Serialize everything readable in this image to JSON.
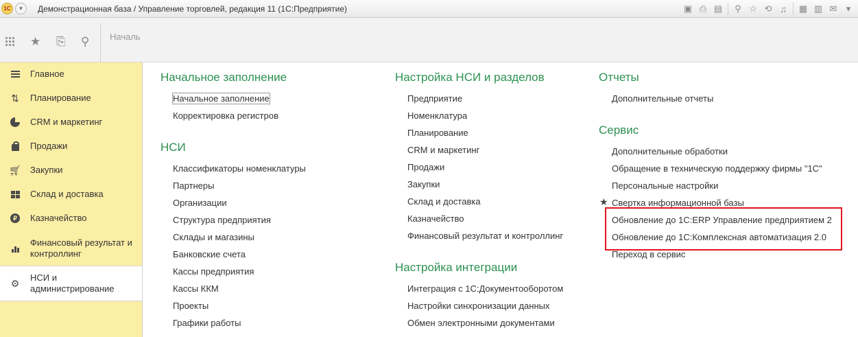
{
  "window": {
    "title": "Демонстрационная база / Управление торговлей, редакция 11  (1С:Предприятие)",
    "logo_text": "1С"
  },
  "tabs": {
    "partial_tab": "Началь"
  },
  "sidebar": {
    "items": [
      {
        "label": "Главное",
        "icon": "hamburger-icon"
      },
      {
        "label": "Планирование",
        "icon": "planning-icon"
      },
      {
        "label": "CRM и маркетинг",
        "icon": "pie-chart-icon"
      },
      {
        "label": "Продажи",
        "icon": "bag-icon"
      },
      {
        "label": "Закупки",
        "icon": "cart-icon"
      },
      {
        "label": "Склад и доставка",
        "icon": "warehouse-icon"
      },
      {
        "label": "Казначейство",
        "icon": "ruble-icon"
      },
      {
        "label": "Финансовый результат и контроллинг",
        "icon": "bar-chart-icon"
      },
      {
        "label": "НСИ и администрирование",
        "icon": "gear-icon",
        "active": true
      }
    ]
  },
  "columns": {
    "col1": {
      "sec1": "Начальное заполнение",
      "sec1_items": [
        "Начальное заполнение",
        "Корректировка регистров"
      ],
      "sec2": "НСИ",
      "sec2_items": [
        "Классификаторы номенклатуры",
        "Партнеры",
        "Организации",
        "Структура предприятия",
        "Склады и магазины",
        "Банковские счета",
        "Кассы предприятия",
        "Кассы ККМ",
        "Проекты",
        "Графики работы"
      ]
    },
    "col2": {
      "sec1": "Настройка НСИ и разделов",
      "sec1_items": [
        "Предприятие",
        "Номенклатура",
        "Планирование",
        "CRM и маркетинг",
        "Продажи",
        "Закупки",
        "Склад и доставка",
        "Казначейство",
        "Финансовый результат и контроллинг"
      ],
      "sec2": "Настройка интеграции",
      "sec2_items": [
        "Интеграция с 1С:Документооборотом",
        "Настройки синхронизации данных",
        "Обмен электронными документами"
      ]
    },
    "col3": {
      "sec1": "Отчеты",
      "sec1_items": [
        "Дополнительные отчеты"
      ],
      "sec2": "Сервис",
      "sec2_items": [
        "Дополнительные обработки",
        "Обращение в техническую поддержку фирмы \"1С\"",
        "Персональные настройки",
        "Свертка информационной базы",
        "Обновление до 1С:ERP Управление предприятием 2",
        "Обновление до 1С:Комплексная автоматизация 2.0",
        "Переход в сервис"
      ]
    }
  },
  "colors": {
    "section": "#2d9152",
    "sidebar_bg": "#fbeea5",
    "highlight": "#e0141e"
  }
}
